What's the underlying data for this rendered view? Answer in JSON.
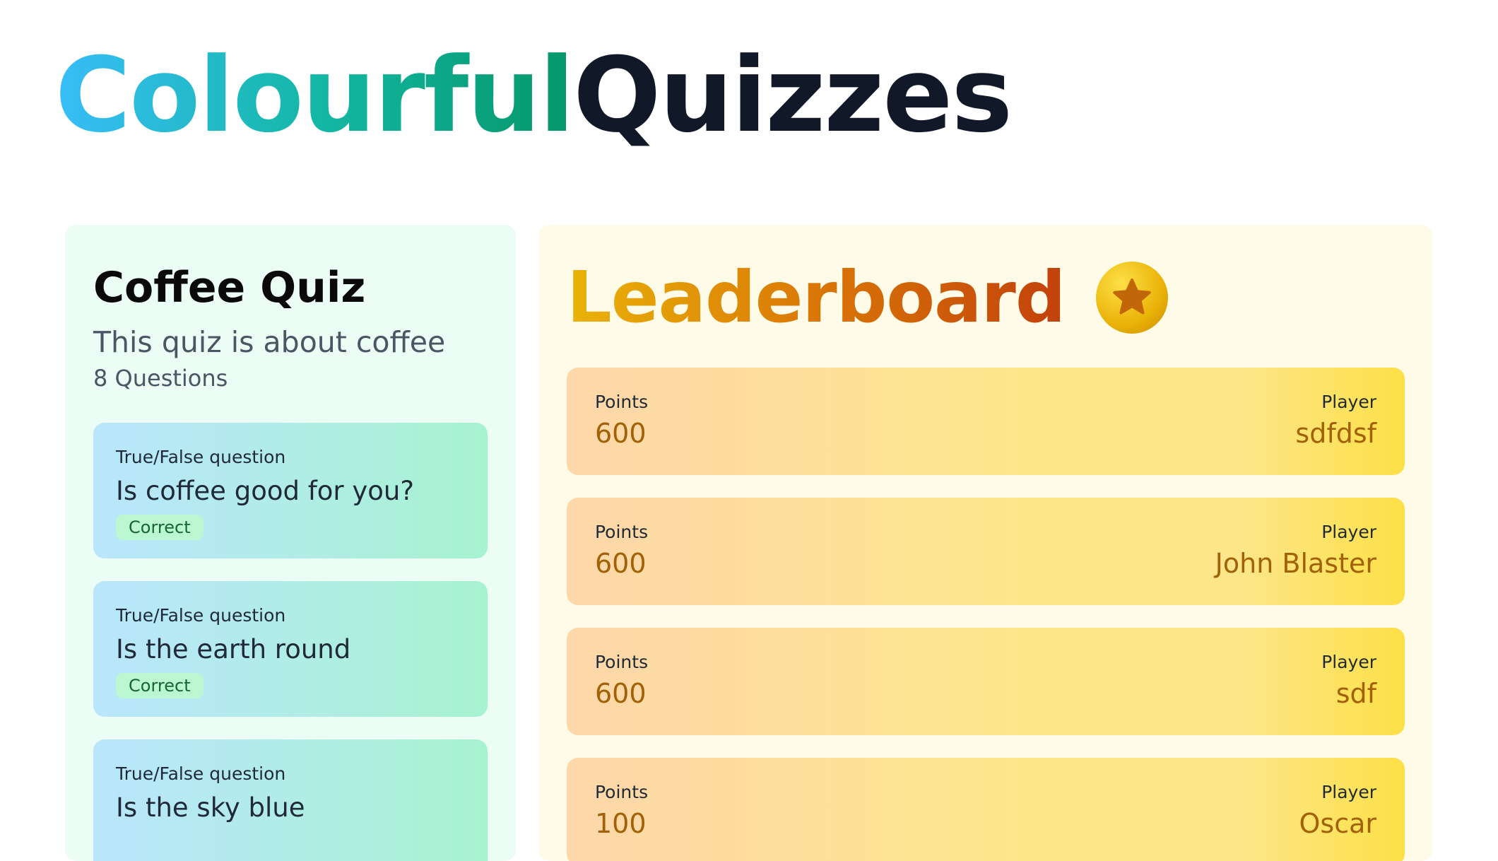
{
  "brand": {
    "part1": "Colourful",
    "part2": "Quizzes"
  },
  "quiz": {
    "title": "Coffee Quiz",
    "description": "This quiz is about coffee",
    "question_count": "8 Questions",
    "questions": [
      {
        "type": "True/False question",
        "text": "Is coffee good for you?",
        "status": "Correct"
      },
      {
        "type": "True/False question",
        "text": "Is the earth round",
        "status": "Correct"
      },
      {
        "type": "True/False question",
        "text": "Is the sky blue",
        "status": ""
      }
    ]
  },
  "leaderboard": {
    "title": "Leaderboard",
    "icon": "star-icon",
    "points_label": "Points",
    "player_label": "Player",
    "rows": [
      {
        "points": "600",
        "player": "sdfdsf"
      },
      {
        "points": "600",
        "player": "John Blaster"
      },
      {
        "points": "600",
        "player": "sdf"
      },
      {
        "points": "100",
        "player": "Oscar"
      }
    ]
  },
  "colors": {
    "quiz_panel_bg": "#ecfdf5",
    "leader_panel_bg": "#fefce8",
    "badge_bg": "#bbf7d0",
    "value_color": "#a16207"
  }
}
